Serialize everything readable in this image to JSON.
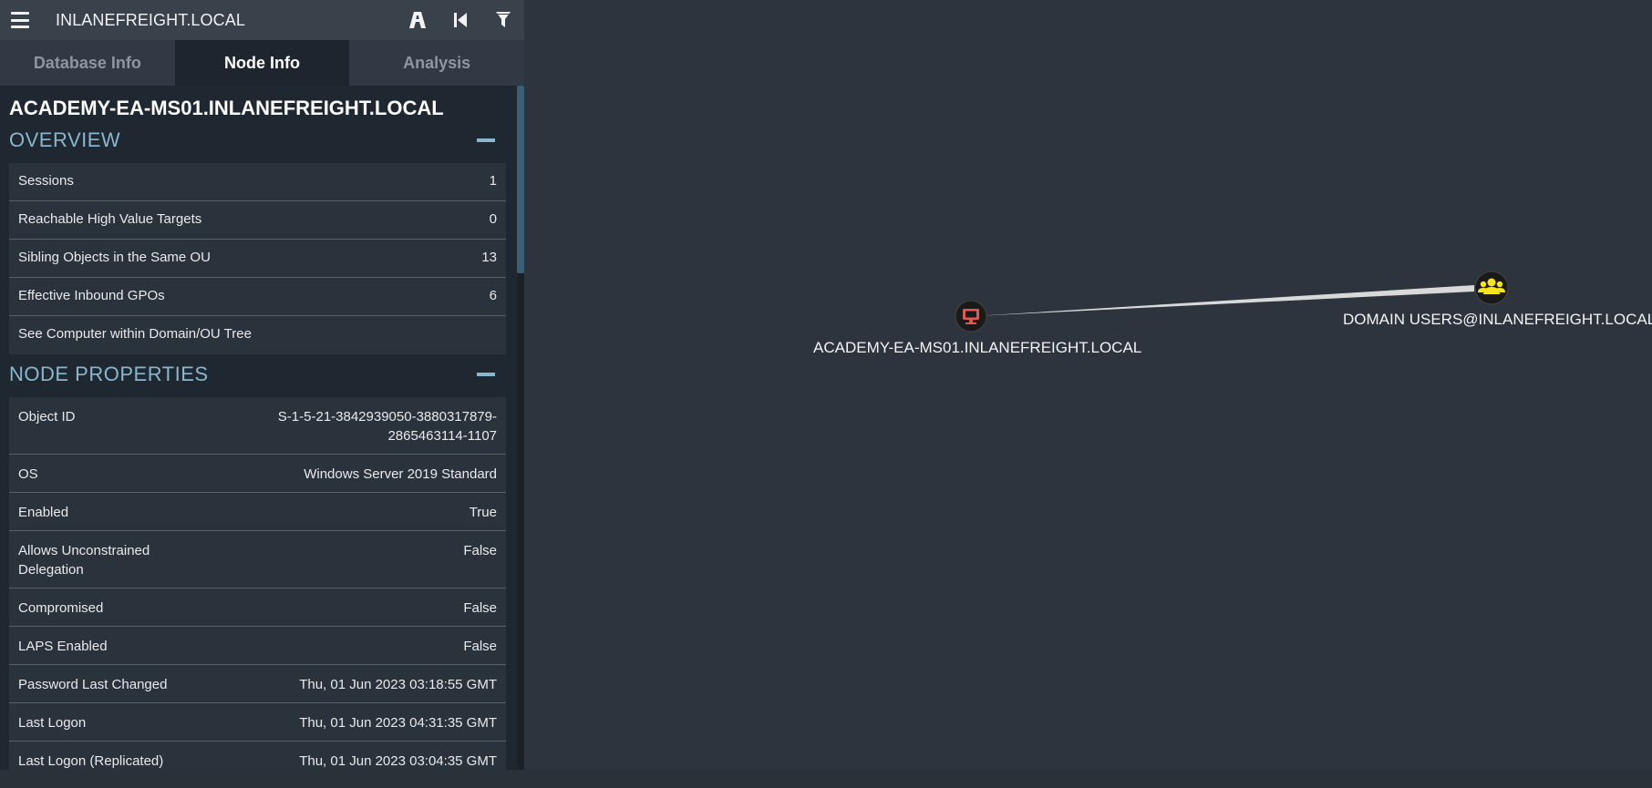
{
  "header": {
    "title": "INLANEFREIGHT.LOCAL"
  },
  "tabs": [
    {
      "label": "Database Info"
    },
    {
      "label": "Node Info"
    },
    {
      "label": "Analysis"
    }
  ],
  "node": {
    "name": "ACADEMY-EA-MS01.INLANEFREIGHT.LOCAL"
  },
  "overview": {
    "heading": "OVERVIEW",
    "rows": [
      {
        "label": "Sessions",
        "value": "1"
      },
      {
        "label": "Reachable High Value Targets",
        "value": "0"
      },
      {
        "label": "Sibling Objects in the Same OU",
        "value": "13"
      },
      {
        "label": "Effective Inbound GPOs",
        "value": "6"
      },
      {
        "label": "See Computer within Domain/OU Tree",
        "value": ""
      }
    ]
  },
  "properties": {
    "heading": "NODE PROPERTIES",
    "rows": [
      {
        "label": "Object ID",
        "value": "S-1-5-21-3842939050-3880317879-2865463114-1107"
      },
      {
        "label": "OS",
        "value": "Windows Server 2019 Standard"
      },
      {
        "label": "Enabled",
        "value": "True"
      },
      {
        "label": "Allows Unconstrained Delegation",
        "value": "False"
      },
      {
        "label": "Compromised",
        "value": "False"
      },
      {
        "label": "LAPS Enabled",
        "value": "False"
      },
      {
        "label": "Password Last Changed",
        "value": "Thu, 01 Jun 2023 03:18:55 GMT"
      },
      {
        "label": "Last Logon",
        "value": "Thu, 01 Jun 2023 04:31:35 GMT"
      },
      {
        "label": "Last Logon (Replicated)",
        "value": "Thu, 01 Jun 2023 03:04:35 GMT"
      }
    ]
  },
  "graph": {
    "nodes": [
      {
        "label": "ACADEMY-EA-MS01.INLANEFREIGHT.LOCAL",
        "icon": "computer-icon",
        "color": "#e05a4e"
      },
      {
        "label": "DOMAIN USERS@INLANEFREIGHT.LOCAL",
        "icon": "group-icon",
        "color": "#f5e31b"
      }
    ]
  },
  "colors": {
    "panel": "#1f2731",
    "canvas": "#2e343d",
    "accent": "#88b7cf"
  }
}
